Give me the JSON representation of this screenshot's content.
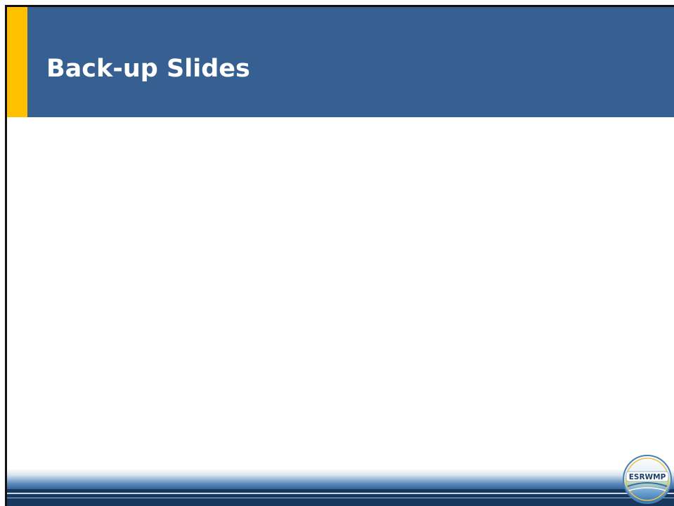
{
  "slide": {
    "title": "Back-up Slides"
  },
  "logo": {
    "text": "ESRWMP"
  },
  "colors": {
    "title_band": "#376092",
    "accent": "#ffc000",
    "footer_dark": "#17375e",
    "title_text": "#ffffff"
  }
}
